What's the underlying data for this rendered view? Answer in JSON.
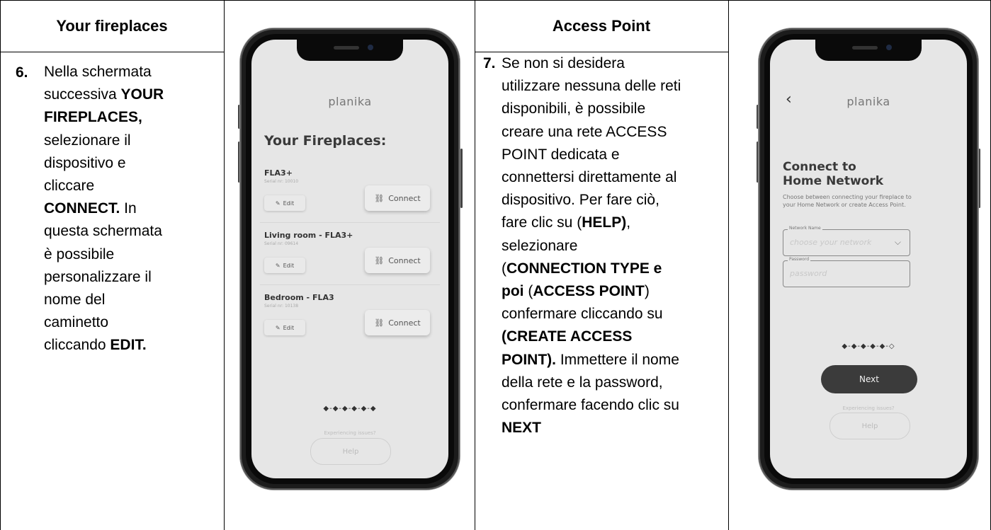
{
  "col1": {
    "header": "Your fireplaces",
    "step_number": "6.",
    "text": {
      "t1": "Nella schermata",
      "t2": "successiva ",
      "b1": "YOUR",
      "b2": "FIREPLACES,",
      "t3": "selezionare il",
      "t4": "dispositivo e",
      "t5": "cliccare",
      "b3": "CONNECT.",
      "t6": " In",
      "t7": "questa schermata",
      "t8": "è possibile",
      "t9": "personalizzare il",
      "t10": "nome del",
      "t11": "caminetto",
      "t12": "cliccando ",
      "b4": "EDIT."
    }
  },
  "col3": {
    "header": "Access Point",
    "step_number": "7.",
    "text": {
      "l1": "Se non si desidera",
      "l2": "utilizzare nessuna delle reti",
      "l3": "disponibili, è possibile",
      "l4": "creare una rete ACCESS",
      "l5": "POINT dedicata e",
      "l6": "connettersi direttamente al",
      "l7": "dispositivo. Per fare ciò,",
      "l8a": "fare clic su (",
      "l8b": "HELP)",
      "l8c": ",",
      "l9": "selezionare",
      "l10a": "(",
      "l10b": "CONNECTION TYPE e",
      "l11a": "poi",
      "l11b": " (",
      "l11c": "ACCESS POINT",
      "l11d": ")",
      "l12": "confermare cliccando su",
      "l13": "(CREATE ACCESS",
      "l14a": "POINT).",
      "l14b": " Immettere il nome",
      "l15": "della rete e la password,",
      "l16": "confermare facendo clic su",
      "l17": "NEXT"
    }
  },
  "phone1": {
    "logo": "planika",
    "title": "Your Fireplaces:",
    "devices": [
      {
        "name": "FLA3+",
        "serial": "Serial nr: 10010",
        "edit": "Edit",
        "connect": "Connect"
      },
      {
        "name": "Living room - FLA3+",
        "serial": "Serial nr: 09614",
        "edit": "Edit",
        "connect": "Connect"
      },
      {
        "name": "Bedroom - FLA3",
        "serial": "Serial nr: 10138",
        "edit": "Edit",
        "connect": "Connect"
      }
    ],
    "progress_dots": "◆-◆-◆-◆-◆-◆",
    "issues": "Experiencing issues?",
    "help": "Help"
  },
  "phone2": {
    "back": "‹",
    "logo": "planika",
    "title_l1": "Connect to",
    "title_l2": "Home Network",
    "subtitle_l1": "Choose between connecting your fireplace to",
    "subtitle_l2": "your Home Network or create Access Point.",
    "network_label": "Network Name",
    "network_placeholder": "choose your network",
    "password_label": "Password",
    "password_placeholder": "password",
    "progress_dots": "◆-◆-◆-◆-◆-◇",
    "next": "Next",
    "issues": "Experiencing issues?",
    "help": "Help"
  }
}
